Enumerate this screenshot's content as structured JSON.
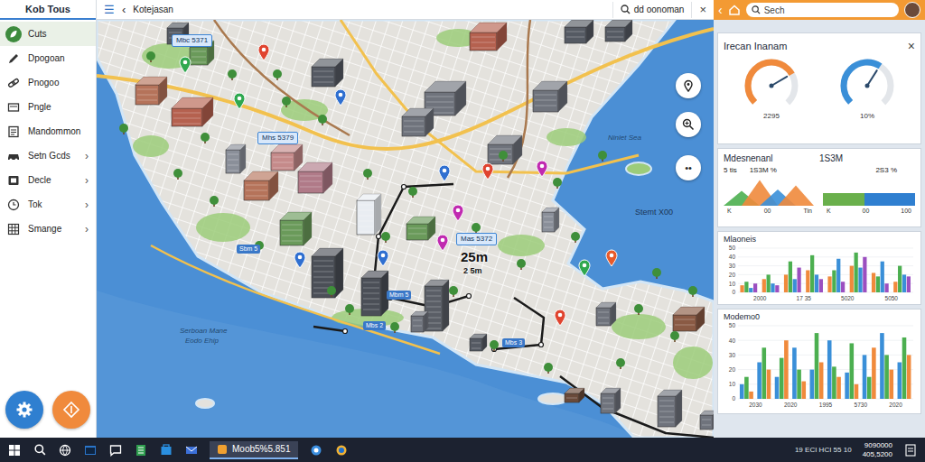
{
  "sidebar": {
    "title": "Kob Tous",
    "items": [
      {
        "label": "Cuts",
        "selected": true
      },
      {
        "label": "Dpogoan",
        "selected": false
      },
      {
        "label": "Pnogoo",
        "selected": false
      },
      {
        "label": "Pngle",
        "selected": false
      },
      {
        "label": "Mandommon",
        "selected": false
      },
      {
        "label": "Setn Gcds",
        "selected": false,
        "arrow": "›"
      },
      {
        "label": "Decle",
        "selected": false,
        "arrow": "›"
      },
      {
        "label": "Tok",
        "selected": false,
        "arrow": "›"
      },
      {
        "label": "Smange",
        "selected": false,
        "arrow": "›"
      }
    ]
  },
  "toolbar": {
    "menu": "☰",
    "back": "‹",
    "title": "Kotejasan",
    "search": "dd oonoman",
    "close": "×"
  },
  "side_toolbar": {
    "back": "‹",
    "search_placeholder": "Sech"
  },
  "map": {
    "labels": [
      {
        "text": "Mbc 5371",
        "kind": "tag"
      },
      {
        "text": "Mhs 5379",
        "kind": "tag"
      },
      {
        "text": "Mas 5372",
        "kind": "tag"
      },
      {
        "text": "Sbm 5",
        "kind": "small"
      },
      {
        "text": "Mbm 5",
        "kind": "small"
      },
      {
        "text": "Mbs 2",
        "kind": "small"
      },
      {
        "text": "Mbs 3",
        "kind": "small"
      },
      {
        "text": "25m",
        "kind": "distance"
      },
      {
        "text": "2 5m",
        "kind": "distance-sub"
      },
      {
        "text": "Stemt X00",
        "kind": "water-big"
      },
      {
        "text": "Serboan Mane",
        "kind": "water"
      },
      {
        "text": "Eodo Ehip",
        "kind": "water"
      },
      {
        "text": "Ninlet Sea",
        "kind": "water"
      }
    ],
    "pins": [
      {
        "color": "#e0442f"
      },
      {
        "color": "#2fa84f"
      },
      {
        "color": "#2fa84f"
      },
      {
        "color": "#2f6fd0"
      },
      {
        "color": "#2f6fd0"
      },
      {
        "color": "#c02ab0"
      },
      {
        "color": "#c02ab0"
      },
      {
        "color": "#c02ab0"
      },
      {
        "color": "#2f6fd0"
      },
      {
        "color": "#2f6fd0"
      },
      {
        "color": "#e0442f"
      },
      {
        "color": "#e85a2a"
      },
      {
        "color": "#2fa84f"
      },
      {
        "color": "#e0442f"
      }
    ],
    "more": "••"
  },
  "panel": {
    "title": "Irecan Inanam",
    "close": "×",
    "gauges": [
      {
        "value": "2295",
        "level": 0.72,
        "color": "#f08a3c"
      },
      {
        "value": "10%",
        "level": 0.62,
        "color": "#3a8fd8"
      }
    ],
    "summary": {
      "title": "Mdesnenanl",
      "value": "1S3M",
      "stats": [
        "5 tis",
        "1S3M %",
        "2S3 %"
      ],
      "peaks": [
        {
          "color": "#4caf50",
          "level": 0.55
        },
        {
          "color": "#f08a3c",
          "level": 0.95
        },
        {
          "color": "#3a8fd8",
          "level": 0.6
        },
        {
          "color": "#f08a3c",
          "level": 0.75
        }
      ],
      "peak_labels": [
        "K",
        "00",
        "Tin"
      ],
      "segments": [
        {
          "color": "#6ab04c",
          "level": 0.45
        },
        {
          "color": "#2f7fd0",
          "level": 0.55
        }
      ],
      "segment_labels": [
        "K",
        "00",
        "100"
      ]
    },
    "charts": [
      {
        "title": "Mlaoneis",
        "y_max": 50,
        "y_ticks": [
          "50",
          "40",
          "30",
          "20",
          "10",
          "0"
        ],
        "x_labels": [
          "2000",
          "17 35",
          "5020",
          "5050"
        ],
        "series": [
          {
            "color": "#f08a3c",
            "values": [
              8,
              15,
              20,
              25,
              18,
              30,
              22,
              12
            ]
          },
          {
            "color": "#4caf50",
            "values": [
              12,
              20,
              35,
              42,
              25,
              45,
              18,
              30
            ]
          },
          {
            "color": "#3a8fd8",
            "values": [
              5,
              10,
              15,
              20,
              38,
              28,
              35,
              20
            ]
          },
          {
            "color": "#9b4fc0",
            "values": [
              10,
              8,
              28,
              15,
              12,
              40,
              10,
              18
            ]
          }
        ]
      },
      {
        "title": "Modemo0",
        "y_max": 50,
        "y_ticks": [
          "50",
          "40",
          "30",
          "20",
          "10",
          "0"
        ],
        "x_labels": [
          "2030",
          "2020",
          "1995",
          "5730",
          "2020"
        ],
        "series": [
          {
            "color": "#3a8fd8",
            "values": [
              10,
              25,
              15,
              35,
              20,
              40,
              18,
              30,
              45,
              25
            ]
          },
          {
            "color": "#4caf50",
            "values": [
              15,
              35,
              28,
              20,
              45,
              22,
              38,
              15,
              30,
              42
            ]
          },
          {
            "color": "#f08a3c",
            "values": [
              5,
              20,
              40,
              12,
              25,
              15,
              10,
              35,
              20,
              30
            ]
          }
        ]
      }
    ]
  },
  "taskbar": {
    "app_label": "Moob5%5.851",
    "tray": "19 ECI HCI 55 10",
    "time": "9090000",
    "date": "405,5200"
  }
}
